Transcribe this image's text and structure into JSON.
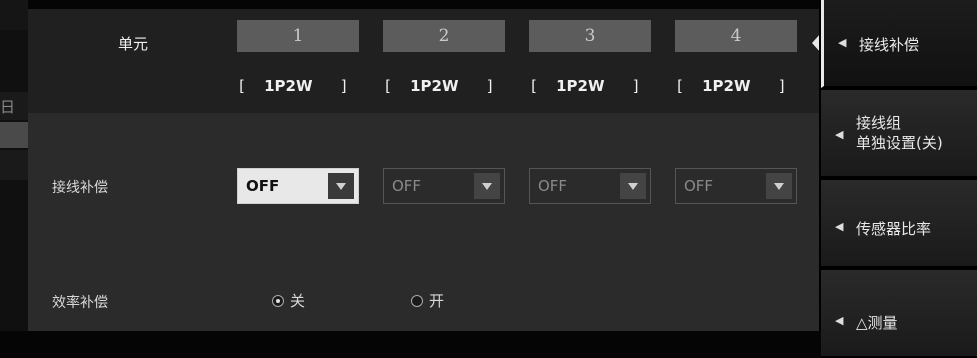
{
  "header": {
    "unit_label": "单元",
    "units": [
      "1",
      "2",
      "3",
      "4"
    ],
    "wiring": [
      "1P2W",
      "1P2W",
      "1P2W",
      "1P2W"
    ],
    "bracket_open": "[",
    "bracket_close": "]"
  },
  "wiring_compensation": {
    "label": "接线补偿",
    "values": [
      "OFF",
      "OFF",
      "OFF",
      "OFF"
    ],
    "active_unit": "1"
  },
  "efficiency_compensation": {
    "label": "效率补偿",
    "options": [
      "关",
      "开"
    ],
    "selected": "关"
  },
  "edge": {
    "glyph": "日"
  },
  "side_menu": {
    "items": [
      {
        "lines": [
          "接线补偿"
        ],
        "selected": true
      },
      {
        "lines": [
          "接线组",
          "单独设置(关)"
        ],
        "selected": false
      },
      {
        "lines": [
          "传感器比率"
        ],
        "selected": false
      },
      {
        "lines": [
          "△测量"
        ],
        "selected": false
      }
    ],
    "arrow_glyph": "◀"
  },
  "colors": {
    "background": "#2b2b2b",
    "header": "#202020",
    "unit_button": "#5c5c5c",
    "active_select": "#e8e8e8"
  }
}
